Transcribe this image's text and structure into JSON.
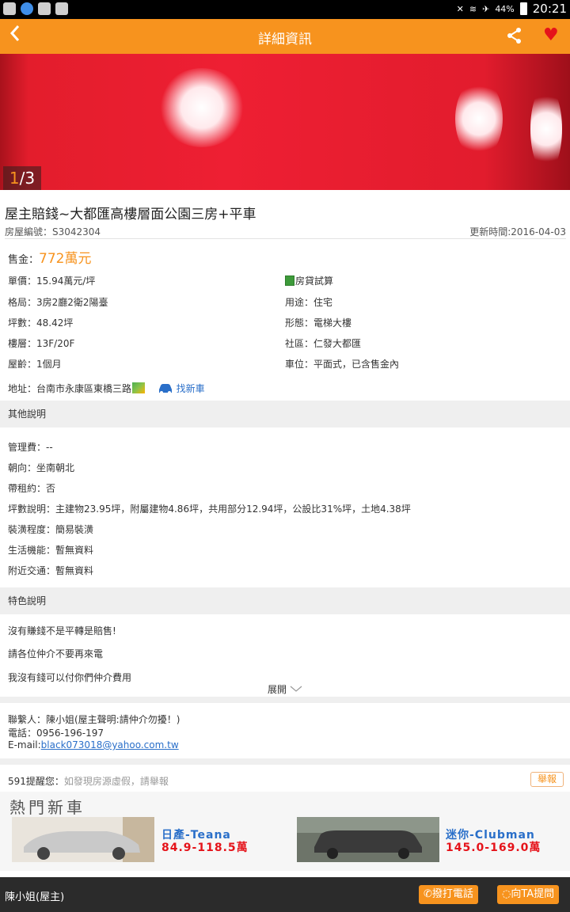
{
  "status_bar": {
    "battery": "44%",
    "time": "20:21"
  },
  "app_bar": {
    "title": "詳細資訊",
    "back_icon": "chevron-left-icon",
    "share_icon": "share-icon",
    "favorite_icon": "heart-icon"
  },
  "gallery": {
    "current": "1",
    "total": "/3"
  },
  "listing": {
    "title": "屋主賠錢~大都匯高樓層面公園三房+平車",
    "id_text": "房屋編號：S3042304",
    "updated_text": "更新時間:2016-04-03",
    "price_label": "售金：",
    "price_value": "772萬元"
  },
  "details": {
    "unit_price": "單價：15.94萬元/坪",
    "loan_calc": "房貸試算",
    "layout": "格局：3房2廳2衛2陽臺",
    "usage": "用途：住宅",
    "area": "坪數：48.42坪",
    "building_type": "形態：電梯大樓",
    "floor": "樓層：13F/20F",
    "community": "社區：仁發大都匯",
    "age": "屋齡：1個月",
    "parking": "車位：平面式，已含售金內",
    "address": "地址：台南市永康區東橋三路",
    "find_car": "找新車"
  },
  "other": {
    "heading": "其他說明",
    "items": [
      "管理費：--",
      "朝向：坐南朝北",
      "帶租約：否",
      "坪數說明：主建物23.95坪，附屬建物4.86坪，共用部分12.94坪，公設比31%坪，土地4.38坪",
      "裝潢程度：簡易裝潢",
      "生活機能：暫無資料",
      "附近交通：暫無資料"
    ]
  },
  "features": {
    "heading": "特色說明",
    "items": [
      "沒有賺錢不是平轉是賠售!",
      "請各位仲介不要再來電",
      "我沒有錢可以付你們仲介費用"
    ],
    "expand_label": "展開"
  },
  "contact": {
    "person": "聯繫人：陳小姐(屋主聲明:請仲介勿擾！)",
    "phone": "電話：0956-196-197",
    "email_label": "E-mail:",
    "email": "black073018@yahoo.com.tw"
  },
  "reminder": {
    "prefix": "591提醒您：",
    "text": "如發現房源虛假，請舉報",
    "report_label": "舉報"
  },
  "ad": {
    "heading": "熱門新車",
    "cars": [
      {
        "name": "日產-Teana",
        "price": "84.9-118.5萬"
      },
      {
        "name": "迷你-Clubman",
        "price": "145.0-169.0萬"
      }
    ]
  },
  "bottom_bar": {
    "owner": "陳小姐(屋主)",
    "call_label": "撥打電話",
    "ask_label": "向TA提問"
  },
  "colors": {
    "accent": "#f7931e",
    "heart": "#e5131a",
    "link": "#2a6fc9"
  }
}
